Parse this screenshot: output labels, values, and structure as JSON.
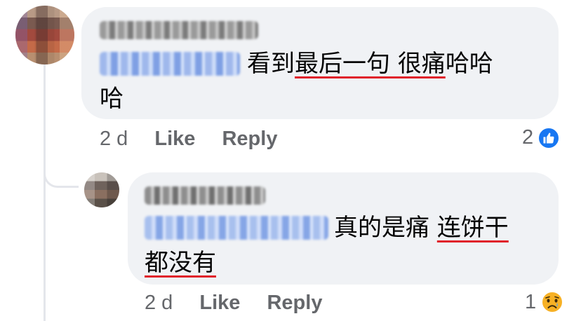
{
  "comments": [
    {
      "text_before": "看到",
      "text_underlined": "最后一句 很痛",
      "text_after_line1": "哈哈",
      "text_line2": "哈",
      "time": "2 d",
      "like_label": "Like",
      "reply_label": "Reply",
      "reaction_count": "2",
      "reaction_icon": "like-icon"
    },
    {
      "text_before": "真的是痛 ",
      "text_underlined_1": "连饼干",
      "text_underlined_2": "都没有",
      "time": "2 d",
      "like_label": "Like",
      "reply_label": "Reply",
      "reaction_count": "1",
      "reaction_icon": "sad-face-icon"
    }
  ],
  "colors": {
    "bubble": "#f0f2f5",
    "meta_text": "#65676b",
    "underline": "#e0202a",
    "like_blue": "#1877f2",
    "sad_yellow": "#f7b125"
  }
}
